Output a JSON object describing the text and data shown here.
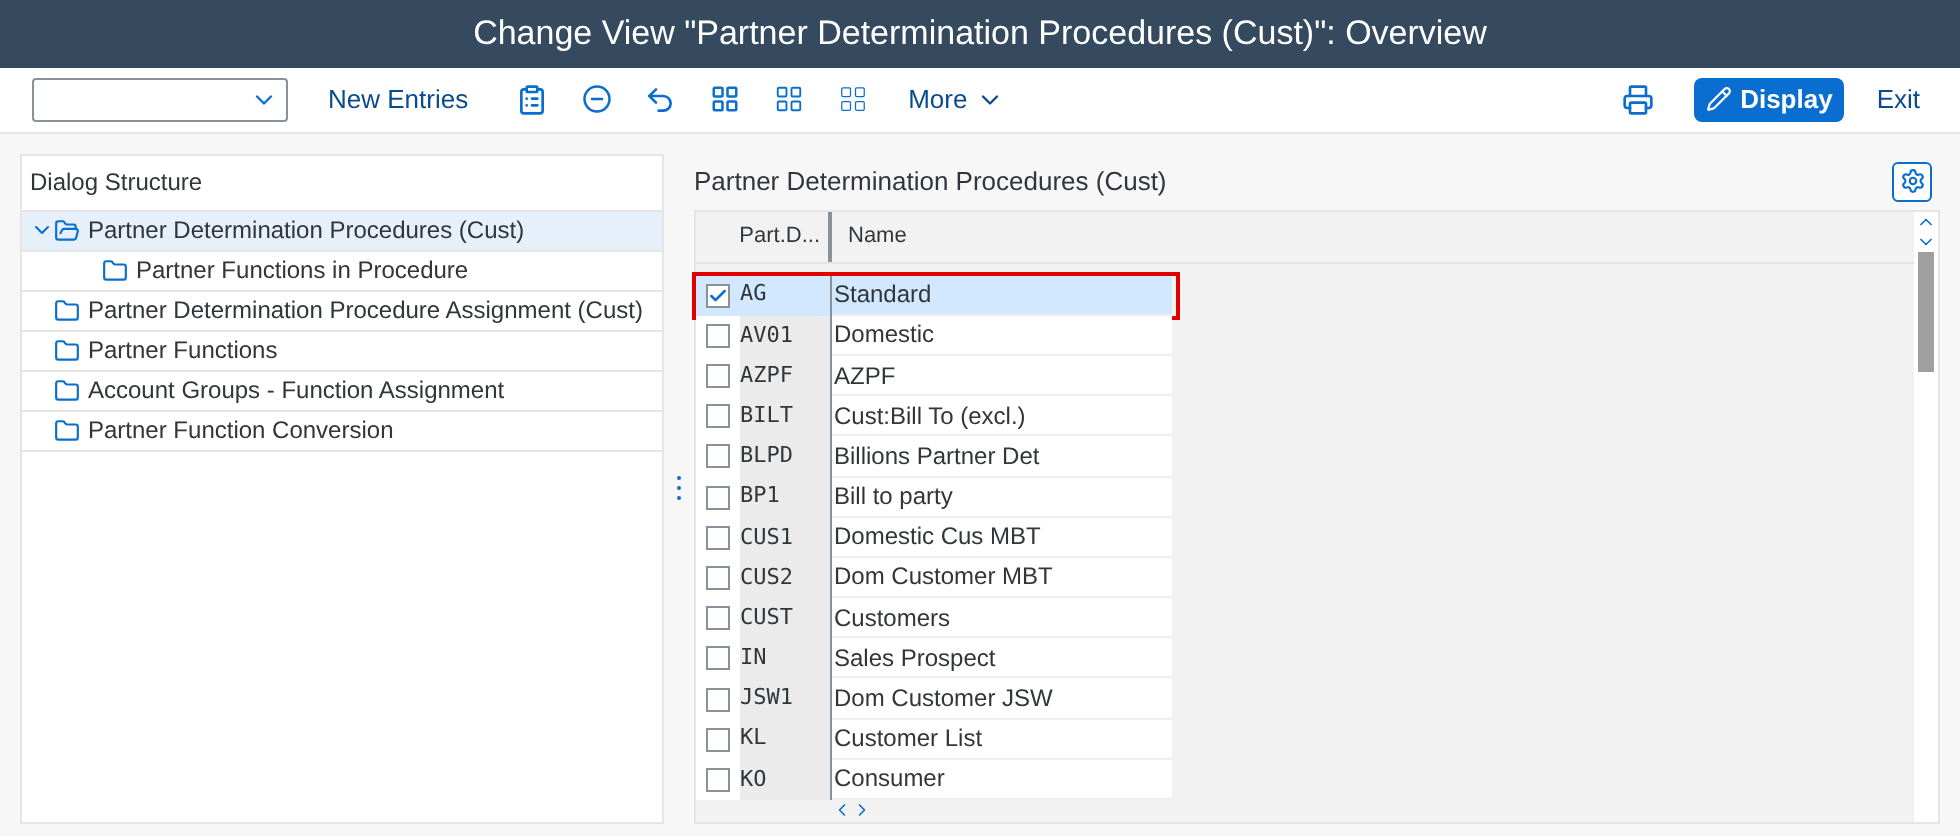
{
  "window": {
    "title": "Change View \"Partner Determination Procedures (Cust)\": Overview"
  },
  "toolbar": {
    "new_entries": "New Entries",
    "more": "More",
    "display": "Display",
    "exit": "Exit"
  },
  "dialog_structure": {
    "title": "Dialog Structure",
    "items": [
      {
        "label": "Partner Determination Procedures (Cust)",
        "selected": true,
        "expanded": true,
        "children": [
          {
            "label": "Partner Functions in Procedure",
            "selected": false
          }
        ]
      },
      {
        "label": "Partner Determination Procedure Assignment (Cust)",
        "selected": false
      },
      {
        "label": "Partner Functions",
        "selected": false
      },
      {
        "label": "Account Groups - Function Assignment",
        "selected": false
      },
      {
        "label": "Partner Function Conversion",
        "selected": false
      }
    ]
  },
  "table": {
    "title": "Partner Determination Procedures (Cust)",
    "columns": [
      "Part.D...",
      "Name"
    ],
    "rows": [
      {
        "code": "AG",
        "name": "Standard",
        "selected": true,
        "highlighted": true
      },
      {
        "code": "AV01",
        "name": "Domestic",
        "selected": false,
        "highlighted": false
      },
      {
        "code": "AZPF",
        "name": "AZPF",
        "selected": false,
        "highlighted": false
      },
      {
        "code": "BILT",
        "name": "Cust:Bill To (excl.)",
        "selected": false,
        "highlighted": false
      },
      {
        "code": "BLPD",
        "name": "Billions Partner Det",
        "selected": false,
        "highlighted": false
      },
      {
        "code": "BP1",
        "name": "Bill to party",
        "selected": false,
        "highlighted": false
      },
      {
        "code": "CUS1",
        "name": "Domestic Cus MBT",
        "selected": false,
        "highlighted": false
      },
      {
        "code": "CUS2",
        "name": "Dom Customer MBT",
        "selected": false,
        "highlighted": false
      },
      {
        "code": "CUST",
        "name": "Customers",
        "selected": false,
        "highlighted": false
      },
      {
        "code": "IN",
        "name": "Sales Prospect",
        "selected": false,
        "highlighted": false
      },
      {
        "code": "JSW1",
        "name": "Dom Customer JSW",
        "selected": false,
        "highlighted": false
      },
      {
        "code": "KL",
        "name": "Customer List",
        "selected": false,
        "highlighted": false
      },
      {
        "code": "KO",
        "name": "Consumer",
        "selected": false,
        "highlighted": false
      }
    ]
  }
}
